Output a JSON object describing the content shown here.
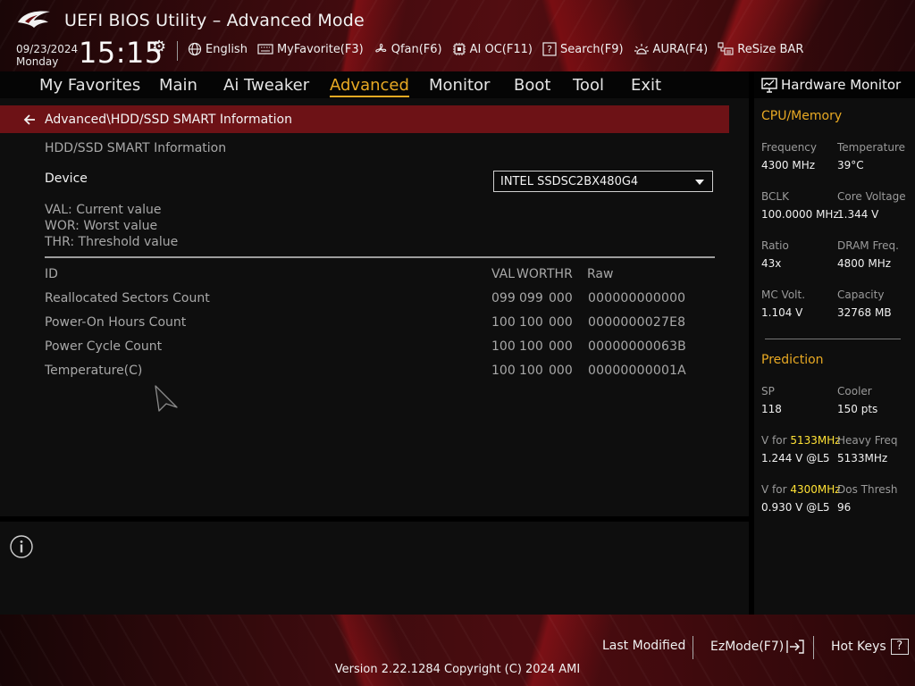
{
  "header": {
    "title": "UEFI BIOS Utility – Advanced Mode",
    "date": "09/23/2024",
    "weekday": "Monday",
    "time": "15:15",
    "toolbar": [
      {
        "label": "English",
        "icon": "globe-icon"
      },
      {
        "label": "MyFavorite(F3)",
        "icon": "keyboard-icon"
      },
      {
        "label": "Qfan(F6)",
        "icon": "fan-icon"
      },
      {
        "label": "AI OC(F11)",
        "icon": "chip-icon"
      },
      {
        "label": "Search(F9)",
        "icon": "question-icon"
      },
      {
        "label": "AURA(F4)",
        "icon": "aura-icon"
      },
      {
        "label": "ReSize BAR",
        "icon": "resize-bar-icon"
      }
    ]
  },
  "nav": {
    "tabs": [
      "My Favorites",
      "Main",
      "Ai Tweaker",
      "Advanced",
      "Monitor",
      "Boot",
      "Tool",
      "Exit"
    ],
    "active": "Advanced"
  },
  "main": {
    "breadcrumb": "Advanced\\HDD/SSD SMART Information",
    "section_title": "HDD/SSD SMART Information",
    "device_label": "Device",
    "device_value": "INTEL SSDSC2BX480G4",
    "legend": [
      "VAL:  Current value",
      "WOR: Worst value",
      "THR:  Threshold value"
    ],
    "columns": {
      "id": "ID",
      "val": "VAL",
      "wor": "WOR",
      "thr": "THR",
      "raw": "Raw"
    },
    "rows": [
      {
        "id": "Reallocated Sectors Count",
        "val": "099",
        "wor": "099",
        "thr": "000",
        "raw": "000000000000"
      },
      {
        "id": "Power-On Hours Count",
        "val": "100",
        "wor": "100",
        "thr": "000",
        "raw": "0000000027E8"
      },
      {
        "id": "Power Cycle Count",
        "val": "100",
        "wor": "100",
        "thr": "000",
        "raw": "00000000063B"
      },
      {
        "id": "Temperature(C)",
        "val": "100",
        "wor": "100",
        "thr": "000",
        "raw": "00000000001A"
      }
    ]
  },
  "hardware_monitor": {
    "title": "Hardware Monitor",
    "cpu_memory": {
      "heading": "CPU/Memory",
      "frequency_label": "Frequency",
      "frequency": "4300 MHz",
      "temperature_label": "Temperature",
      "temperature": "39°C",
      "bclk_label": "BCLK",
      "bclk": "100.0000 MHz",
      "core_voltage_label": "Core Voltage",
      "core_voltage": "1.344 V",
      "ratio_label": "Ratio",
      "ratio": "43x",
      "dram_freq_label": "DRAM Freq.",
      "dram_freq": "4800 MHz",
      "mc_volt_label": "MC Volt.",
      "mc_volt": "1.104 V",
      "capacity_label": "Capacity",
      "capacity": "32768 MB"
    },
    "prediction": {
      "heading": "Prediction",
      "sp_label": "SP",
      "sp": "118",
      "cooler_label": "Cooler",
      "cooler": "150 pts",
      "v_for_label": "V for",
      "v_for_1_freq": "5133MHz",
      "v_for_1": "1.244 V @L5",
      "heavy_freq_label": "Heavy Freq",
      "heavy_freq": "5133MHz",
      "v_for_2_freq": "4300MHz",
      "v_for_2": "0.930 V @L5",
      "dos_thresh_label": "Dos Thresh",
      "dos_thresh": "96"
    }
  },
  "footer": {
    "last_modified": "Last Modified",
    "ezmode": "EzMode(F7)",
    "hot_keys": "Hot Keys",
    "hot_keys_key": "?",
    "version": "Version 2.22.1284 Copyright (C) 2024 AMI"
  },
  "colors": {
    "accent": "#e8a923",
    "breadcrumb_bg": "#6d1216",
    "highlight": "#ffe135"
  }
}
